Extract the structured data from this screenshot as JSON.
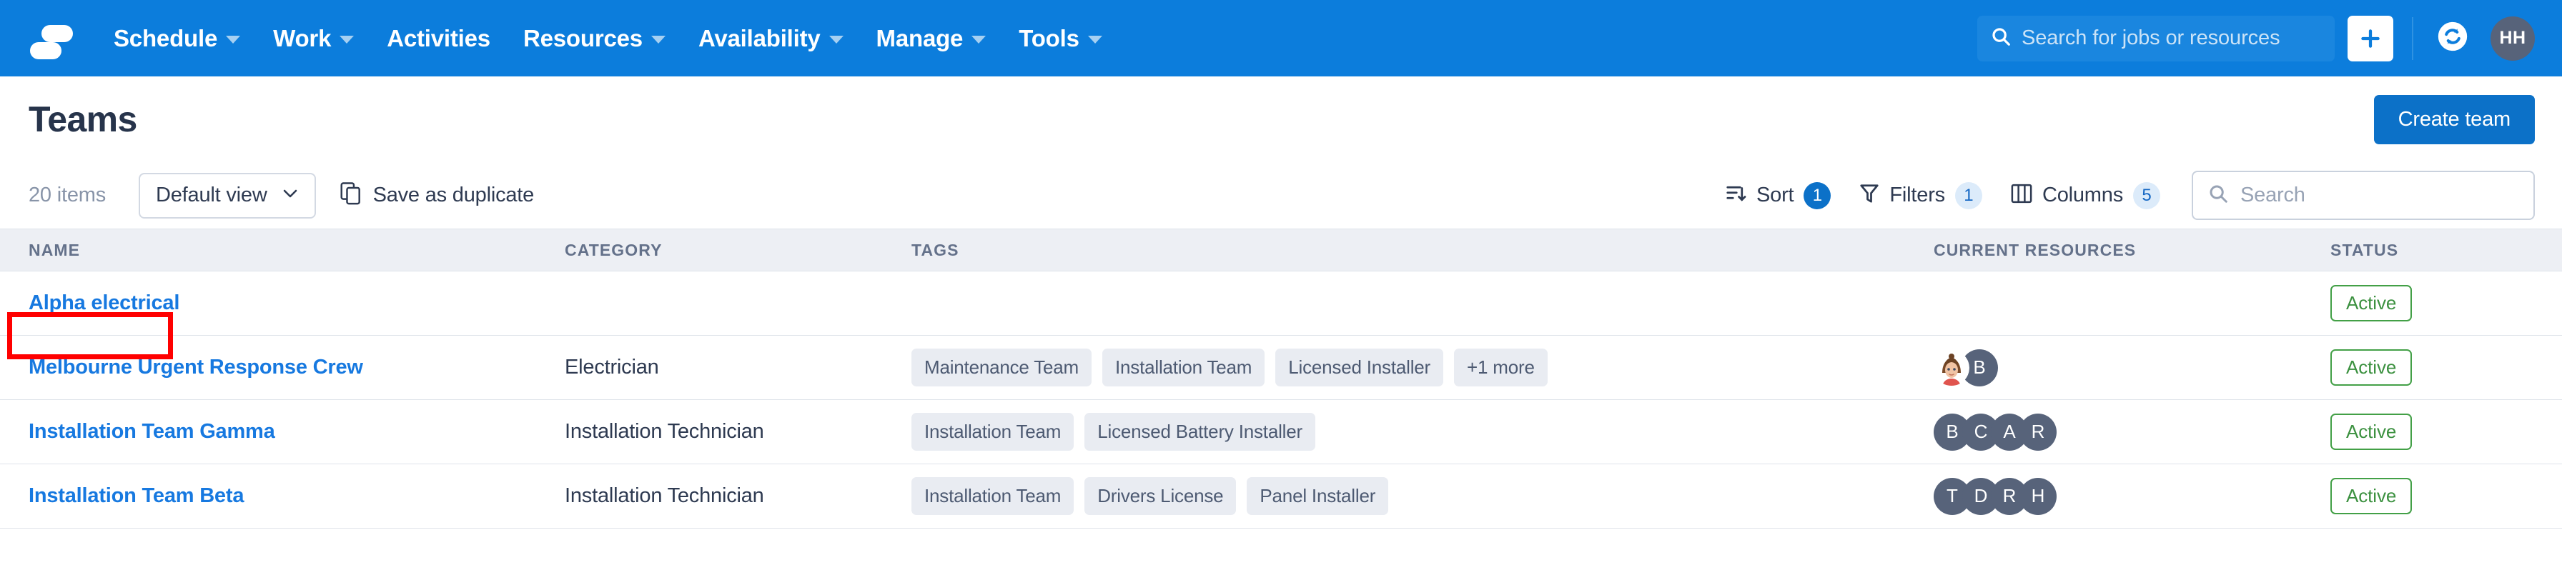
{
  "brand": {
    "logo_icon": "skedulo-logo-icon",
    "nav_bg": "#0c7ddc",
    "accent": "#0c71c8",
    "link_color": "#1779e0",
    "status_green": "#3c9140",
    "highlight_color": "#ff0000"
  },
  "topnav": {
    "items": [
      {
        "label": "Schedule",
        "has_caret": true
      },
      {
        "label": "Work",
        "has_caret": true
      },
      {
        "label": "Activities",
        "has_caret": false
      },
      {
        "label": "Resources",
        "has_caret": true
      },
      {
        "label": "Availability",
        "has_caret": true
      },
      {
        "label": "Manage",
        "has_caret": true
      },
      {
        "label": "Tools",
        "has_caret": true
      }
    ],
    "search_placeholder": "Search for jobs or resources",
    "search_icon": "search-icon",
    "create_icon": "plus-icon",
    "sync_icon": "sync-icon",
    "avatar_initials": "HH"
  },
  "header": {
    "title": "Teams",
    "create_button": "Create team"
  },
  "toolbar": {
    "items_count": "20 items",
    "view_label": "Default view",
    "view_caret_icon": "chevron-down-icon",
    "save_duplicate_label": "Save as duplicate",
    "save_duplicate_icon": "duplicate-icon",
    "sort": {
      "label": "Sort",
      "badge": "1",
      "icon": "sort-icon"
    },
    "filters": {
      "label": "Filters",
      "badge": "1",
      "icon": "filter-icon"
    },
    "columns": {
      "label": "Columns",
      "badge": "5",
      "icon": "columns-icon"
    },
    "search_placeholder": "Search",
    "search_icon": "search-icon"
  },
  "table": {
    "columns": [
      "NAME",
      "CATEGORY",
      "TAGS",
      "CURRENT RESOURCES",
      "STATUS"
    ],
    "rows": [
      {
        "name": "Alpha electrical",
        "category": "",
        "tags": [],
        "resources": [],
        "status": "Active",
        "highlighted": true
      },
      {
        "name": "Melbourne Urgent Response Crew",
        "category": "Electrician",
        "tags": [
          "Maintenance Team",
          "Installation Team",
          "Licensed Installer",
          "+1 more"
        ],
        "resources": [
          {
            "type": "photo",
            "initial": ""
          },
          {
            "type": "initial",
            "initial": "B"
          }
        ],
        "status": "Active",
        "highlighted": false
      },
      {
        "name": "Installation Team Gamma",
        "category": "Installation Technician",
        "tags": [
          "Installation Team",
          "Licensed Battery Installer"
        ],
        "resources": [
          {
            "type": "initial",
            "initial": "B"
          },
          {
            "type": "initial",
            "initial": "C"
          },
          {
            "type": "initial",
            "initial": "A"
          },
          {
            "type": "initial",
            "initial": "R"
          }
        ],
        "status": "Active",
        "highlighted": false
      },
      {
        "name": "Installation Team Beta",
        "category": "Installation Technician",
        "tags": [
          "Installation Team",
          "Drivers License",
          "Panel Installer"
        ],
        "resources": [
          {
            "type": "initial",
            "initial": "T"
          },
          {
            "type": "initial",
            "initial": "D"
          },
          {
            "type": "initial",
            "initial": "R"
          },
          {
            "type": "initial",
            "initial": "H"
          }
        ],
        "status": "Active",
        "highlighted": false
      }
    ]
  }
}
